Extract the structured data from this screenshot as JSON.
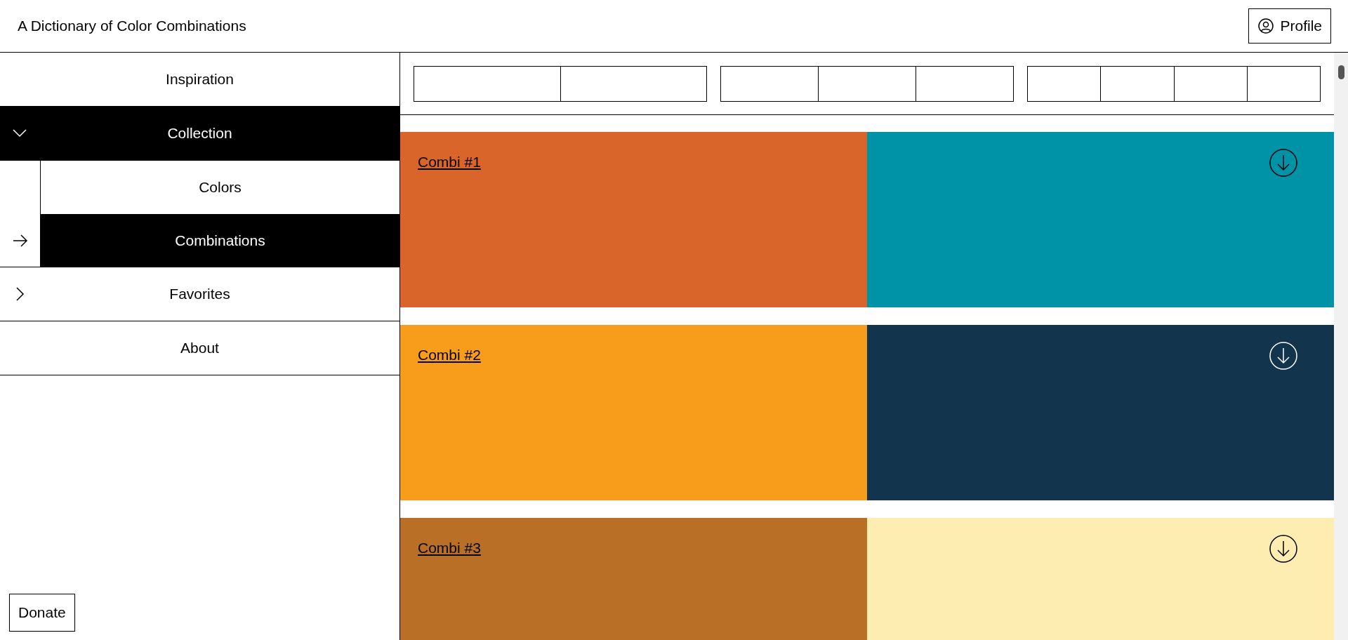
{
  "header": {
    "title": "A Dictionary of Color Combinations",
    "profile_button": "Profile"
  },
  "sidebar": {
    "items": [
      {
        "label": "Inspiration",
        "selected": false
      },
      {
        "label": "Collection",
        "selected": true,
        "expanded": true,
        "children": [
          {
            "label": "Colors",
            "selected": false
          },
          {
            "label": "Combinations",
            "selected": true
          }
        ]
      },
      {
        "label": "Favorites",
        "selected": false,
        "expanded": false
      },
      {
        "label": "About",
        "selected": false
      }
    ],
    "donate_button": "Donate"
  },
  "combinations": [
    {
      "title": "Combi #1",
      "swatches": [
        {
          "color": "#d9652a"
        },
        {
          "color": "#0093a7"
        }
      ]
    },
    {
      "title": "Combi #2",
      "swatches": [
        {
          "color": "#f89c1c"
        },
        {
          "color": "#13344d"
        }
      ]
    },
    {
      "title": "Combi #3",
      "swatches": [
        {
          "color": "#b96f26"
        },
        {
          "color": "#fdedb0"
        }
      ]
    }
  ]
}
